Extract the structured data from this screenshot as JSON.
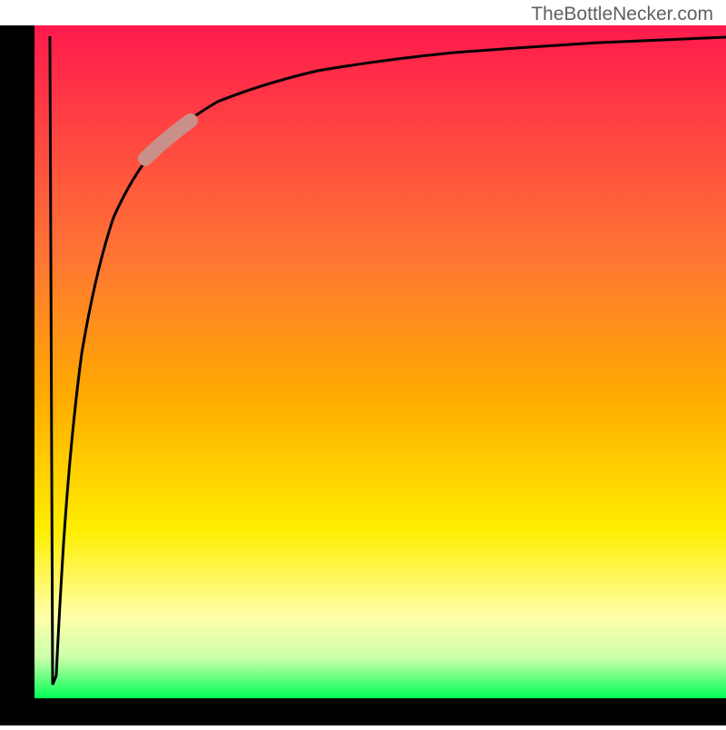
{
  "watermark": "TheBottleNecker.com",
  "chart_data": {
    "type": "line",
    "title": "",
    "xlabel": "",
    "ylabel": "",
    "xlim": [
      0,
      100
    ],
    "ylim": [
      0,
      100
    ],
    "background": {
      "type": "vertical-gradient",
      "stops": [
        {
          "position": 0,
          "color": "#ff1a4d"
        },
        {
          "position": 50,
          "color": "#ffaa00"
        },
        {
          "position": 80,
          "color": "#ffff00"
        },
        {
          "position": 92,
          "color": "#ffffaa"
        },
        {
          "position": 100,
          "color": "#00ff55"
        }
      ]
    },
    "curve": {
      "description": "Sharp dip from top-left to bottom then logarithmic rise to top-right",
      "points": [
        {
          "x": 4.5,
          "y": 3
        },
        {
          "x": 5.2,
          "y": 97
        },
        {
          "x": 6,
          "y": 85
        },
        {
          "x": 7,
          "y": 70
        },
        {
          "x": 8,
          "y": 58
        },
        {
          "x": 10,
          "y": 45
        },
        {
          "x": 12,
          "y": 36
        },
        {
          "x": 15,
          "y": 28
        },
        {
          "x": 18,
          "y": 22
        },
        {
          "x": 22,
          "y": 17
        },
        {
          "x": 28,
          "y": 13
        },
        {
          "x": 35,
          "y": 10
        },
        {
          "x": 45,
          "y": 8
        },
        {
          "x": 55,
          "y": 6.5
        },
        {
          "x": 70,
          "y": 5
        },
        {
          "x": 85,
          "y": 4
        },
        {
          "x": 100,
          "y": 3
        }
      ]
    },
    "highlight_segment": {
      "color": "#c89088",
      "x_range": [
        18,
        26
      ],
      "y_range": [
        16,
        22
      ]
    },
    "axes": {
      "left_border": true,
      "bottom_border": true,
      "color": "#000000",
      "width": 25
    }
  }
}
